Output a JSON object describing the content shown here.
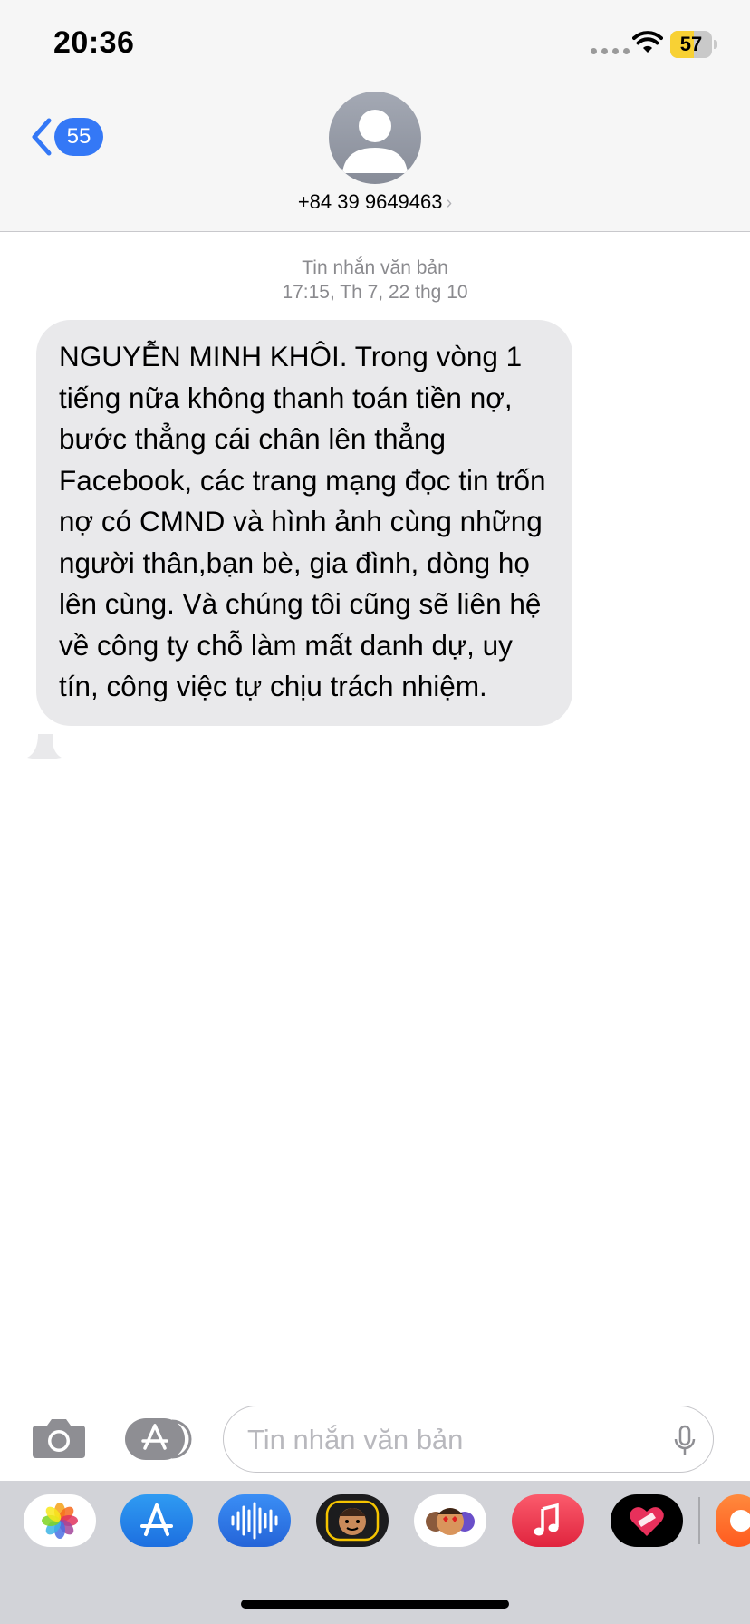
{
  "status_bar": {
    "time": "20:36",
    "battery_level": "57"
  },
  "header": {
    "back_badge": "55",
    "contact": "+84 39 9649463",
    "contact_chevron": "›"
  },
  "conversation": {
    "message_type": "Tin nhắn văn bản",
    "timestamp": "17:15, Th 7, 22 thg 10",
    "message_text": "NGUYỄN MINH KHÔI. Trong vòng 1 tiếng nữa không thanh toán tiền nợ, bước thẳng cái chân lên thẳng Facebook, các trang mạng đọc tin trốn nợ có CMND và hình ảnh cùng những người thân,bạn bè, gia đình, dòng họ lên cùng. Và chúng tôi cũng sẽ liên hệ về công ty chỗ làm mất danh dự, uy tín, công việc tự chịu trách nhiệm."
  },
  "compose": {
    "placeholder": "Tin nhắn văn bản"
  },
  "app_drawer": {
    "apps": [
      "photos-icon",
      "app-store-icon",
      "audio-message-icon",
      "memoji-icon",
      "animoji-stickers-icon",
      "music-icon",
      "digital-touch-icon",
      "more-app-icon"
    ]
  },
  "colors": {
    "accent": "#3478f6",
    "bubble": "#e9e9eb",
    "battery": "#f8d134"
  }
}
